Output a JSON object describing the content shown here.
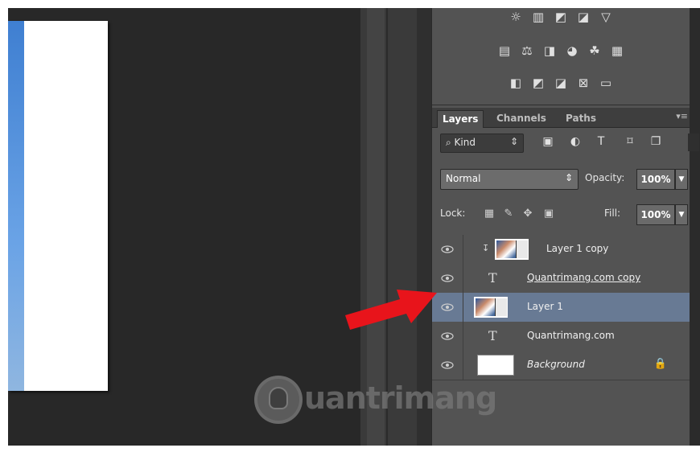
{
  "adjustments": {
    "row1": [
      "brightness-contrast-icon",
      "levels-icon",
      "curves-icon",
      "exposure-icon",
      "vibrance-icon"
    ],
    "row2": [
      "hue-saturation-icon",
      "color-balance-icon",
      "black-white-icon",
      "photo-filter-icon",
      "channel-mixer-icon",
      "color-lookup-icon"
    ],
    "row3": [
      "invert-icon",
      "posterize-icon",
      "threshold-icon",
      "selective-color-icon",
      "gradient-map-icon"
    ]
  },
  "tabs": {
    "layers": "Layers",
    "channels": "Channels",
    "paths": "Paths"
  },
  "filter": {
    "kind_label": "⌕ Kind"
  },
  "blend": {
    "mode": "Normal",
    "opacity_label": "Opacity:",
    "opacity": "100%"
  },
  "lock": {
    "label": "Lock:",
    "fill_label": "Fill:",
    "fill": "100%"
  },
  "layers": [
    {
      "name": "Layer 1 copy",
      "type": "image",
      "clipped": true,
      "selected": false
    },
    {
      "name": "Quantrimang.com copy",
      "type": "text",
      "selected": false
    },
    {
      "name": "Layer 1",
      "type": "image",
      "selected": true
    },
    {
      "name": "Quantrimang.com",
      "type": "text",
      "selected": false
    },
    {
      "name": "Background",
      "type": "background",
      "locked": true,
      "selected": false
    }
  ],
  "icons": {
    "clip": "↧",
    "text": "T",
    "lock": "ὑ2"
  },
  "watermark": {
    "text": "uantrimang"
  },
  "colors": {
    "selected_row": "#687a94",
    "panel": "#535353",
    "arrow": "#e8141b"
  }
}
